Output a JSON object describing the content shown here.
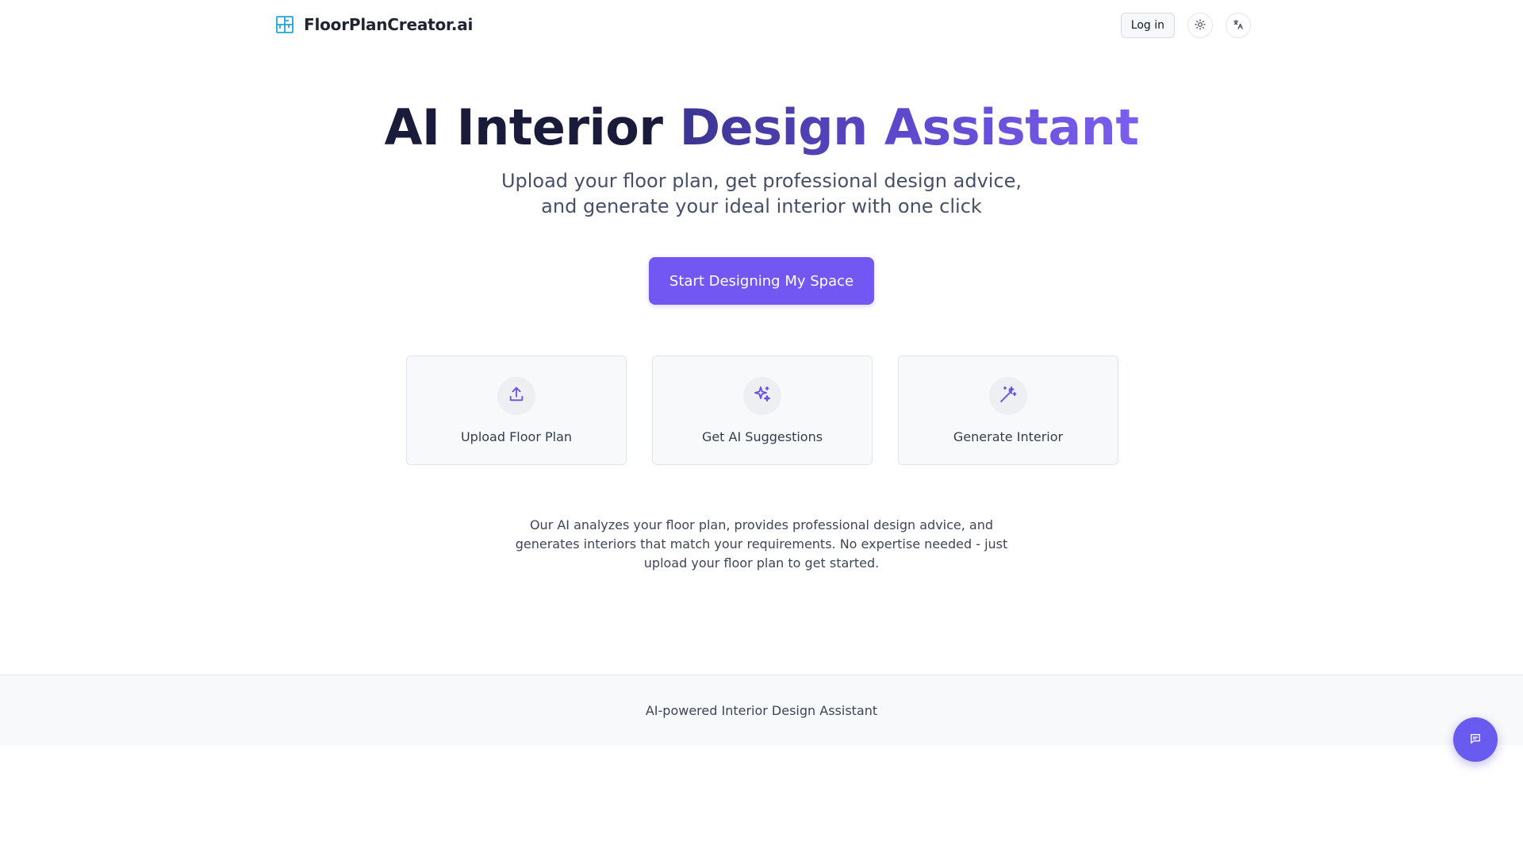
{
  "header": {
    "brand_name": "FloorPlanCreator.ai",
    "brand_icon": "floor-plan-grid-icon",
    "login_label": "Log in",
    "theme_icon": "sun-icon",
    "language_icon": "translate-icon"
  },
  "hero": {
    "title_part1": "AI Interior",
    "title_part2": "Design Assistant",
    "subtitle_line1": "Upload your floor plan, get professional design advice,",
    "subtitle_line2": "and generate your ideal interior with one click",
    "cta_label": "Start Designing My Space"
  },
  "features": [
    {
      "label": "Upload Floor Plan",
      "icon": "upload-icon"
    },
    {
      "label": "Get AI Suggestions",
      "icon": "sparkles-icon"
    },
    {
      "label": "Generate Interior",
      "icon": "magic-wand-icon"
    }
  ],
  "description": "Our AI analyzes your floor plan, provides professional design advice, and generates interiors that match your requirements. No expertise needed - just upload your floor plan to get started.",
  "footer": {
    "text": "AI-powered Interior Design Assistant"
  },
  "chat": {
    "icon": "chat-icon"
  },
  "colors": {
    "accent": "#7357f3",
    "title_dark": "#1a1b3a",
    "brand_icon": "#1fa6d9",
    "chat_button": "#6a5bf0"
  }
}
